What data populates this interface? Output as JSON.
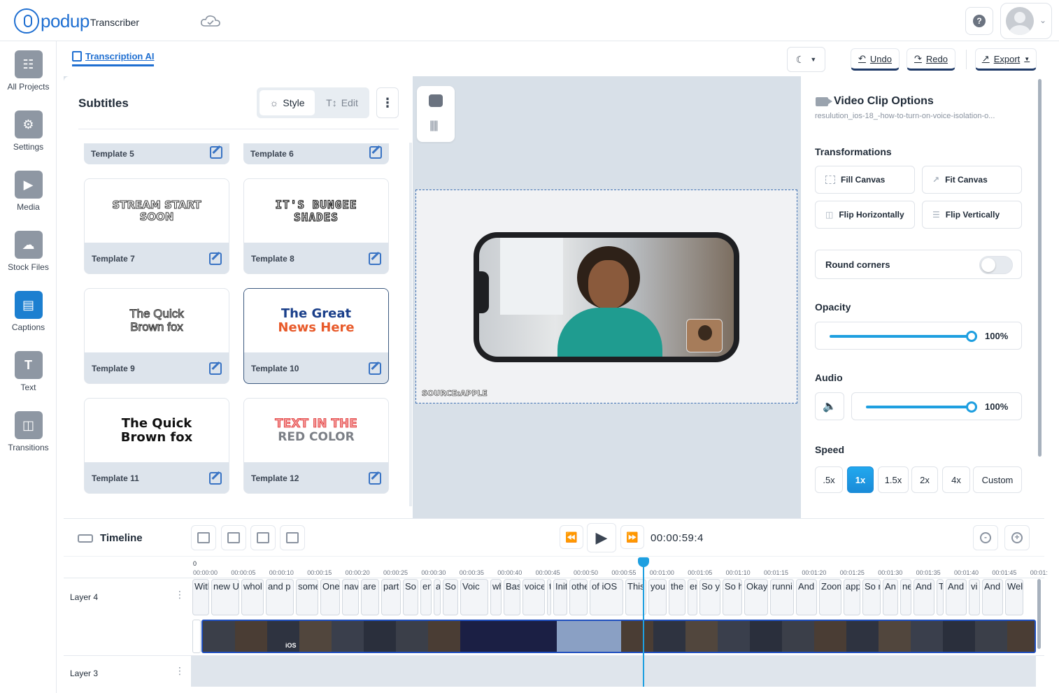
{
  "app": {
    "logo_text": "podup",
    "logo_sub": "Transcriber"
  },
  "sidebar": {
    "items": [
      {
        "label": "All Projects",
        "icon": "projects-icon"
      },
      {
        "label": "Settings",
        "icon": "gear-icon"
      },
      {
        "label": "Media",
        "icon": "media-icon"
      },
      {
        "label": "Stock Files",
        "icon": "cloud-icon"
      },
      {
        "label": "Captions",
        "icon": "captions-icon"
      },
      {
        "label": "Text",
        "icon": "text-icon"
      },
      {
        "label": "Transitions",
        "icon": "transitions-icon"
      }
    ],
    "active": "Captions"
  },
  "toolbar": {
    "tab_label": "Transcription AI",
    "undo": "Undo",
    "redo": "Redo",
    "export": "Export"
  },
  "subtitles": {
    "title": "Subtitles",
    "style_label": "Style",
    "edit_label": "Edit",
    "templates": [
      {
        "name": "Template 5",
        "preview": ""
      },
      {
        "name": "Template 6",
        "preview": ""
      },
      {
        "name": "Template 7",
        "preview_lines": [
          "STREAM START",
          "SOON"
        ]
      },
      {
        "name": "Template 8",
        "preview_lines": [
          "IT'S BUNGEE",
          "SHADES"
        ]
      },
      {
        "name": "Template 9",
        "preview_lines": [
          "The Quick",
          "Brown fox"
        ]
      },
      {
        "name": "Template 10",
        "preview_lines": [
          "The Great",
          "News Here"
        ],
        "selected": true
      },
      {
        "name": "Template 11",
        "preview_lines": [
          "The Quick",
          "Brown fox"
        ]
      },
      {
        "name": "Template 12",
        "preview_lines": [
          "TEXT IN THE",
          "RED COLOR"
        ]
      }
    ]
  },
  "canvas": {
    "source_label": "SOURCE:APPLE"
  },
  "options": {
    "title": "Video Clip Options",
    "file_name": "resulution_ios-18_-how-to-turn-on-voice-isolation-o...",
    "transformations_label": "Transformations",
    "fill_canvas": "Fill Canvas",
    "fit_canvas": "Fit Canvas",
    "flip_h": "Flip Horizontally",
    "flip_v": "Flip Vertically",
    "round_corners": "Round corners",
    "round_corners_on": false,
    "opacity_label": "Opacity",
    "opacity_value": "100%",
    "opacity_level": 1.0,
    "audio_label": "Audio",
    "audio_value": "100%",
    "audio_level": 1.0,
    "speed_label": "Speed",
    "speeds": [
      ".5x",
      "1x",
      "1.5x",
      "2x",
      "4x",
      "Custom"
    ],
    "speed_active": "1x"
  },
  "timeline": {
    "title": "Timeline",
    "time": "00:00:59:4",
    "ruler_zero": "0",
    "ticks": [
      "00:00:00",
      "00:00:05",
      "00:00:10",
      "00:00:15",
      "00:00:20",
      "00:00:25",
      "00:00:30",
      "00:00:35",
      "00:00:40",
      "00:00:45",
      "00:00:50",
      "00:00:55",
      "00:01:00",
      "00:01:05",
      "00:01:10",
      "00:01:15",
      "00:01:20",
      "00:01:25",
      "00:01:30",
      "00:01:35",
      "00:01:40",
      "00:01:45",
      "00:01:"
    ],
    "layers": [
      "Layer 4",
      "Layer 3"
    ],
    "subtitle_clips": [
      "With",
      "new U",
      "whol",
      "and p",
      "some",
      "One",
      "nav",
      "are",
      "part",
      "So",
      "enc",
      "a",
      "So v",
      "Voic",
      "wh",
      "Bas",
      "voice",
      "t",
      "Init",
      "othe",
      "of iOS",
      "This",
      "you",
      "the",
      "en",
      "So ye",
      "So ho",
      "Okay",
      "runni",
      "And",
      "Zoom",
      "app",
      "So n",
      "An",
      "ne",
      "And",
      "T",
      "And",
      "vi",
      "And t",
      "Wel"
    ],
    "video_overlay_text": "iOS"
  },
  "colors": {
    "brand": "#1f6fd1",
    "accent": "#1e9fe0",
    "active_speed": "#1a8bd8"
  }
}
